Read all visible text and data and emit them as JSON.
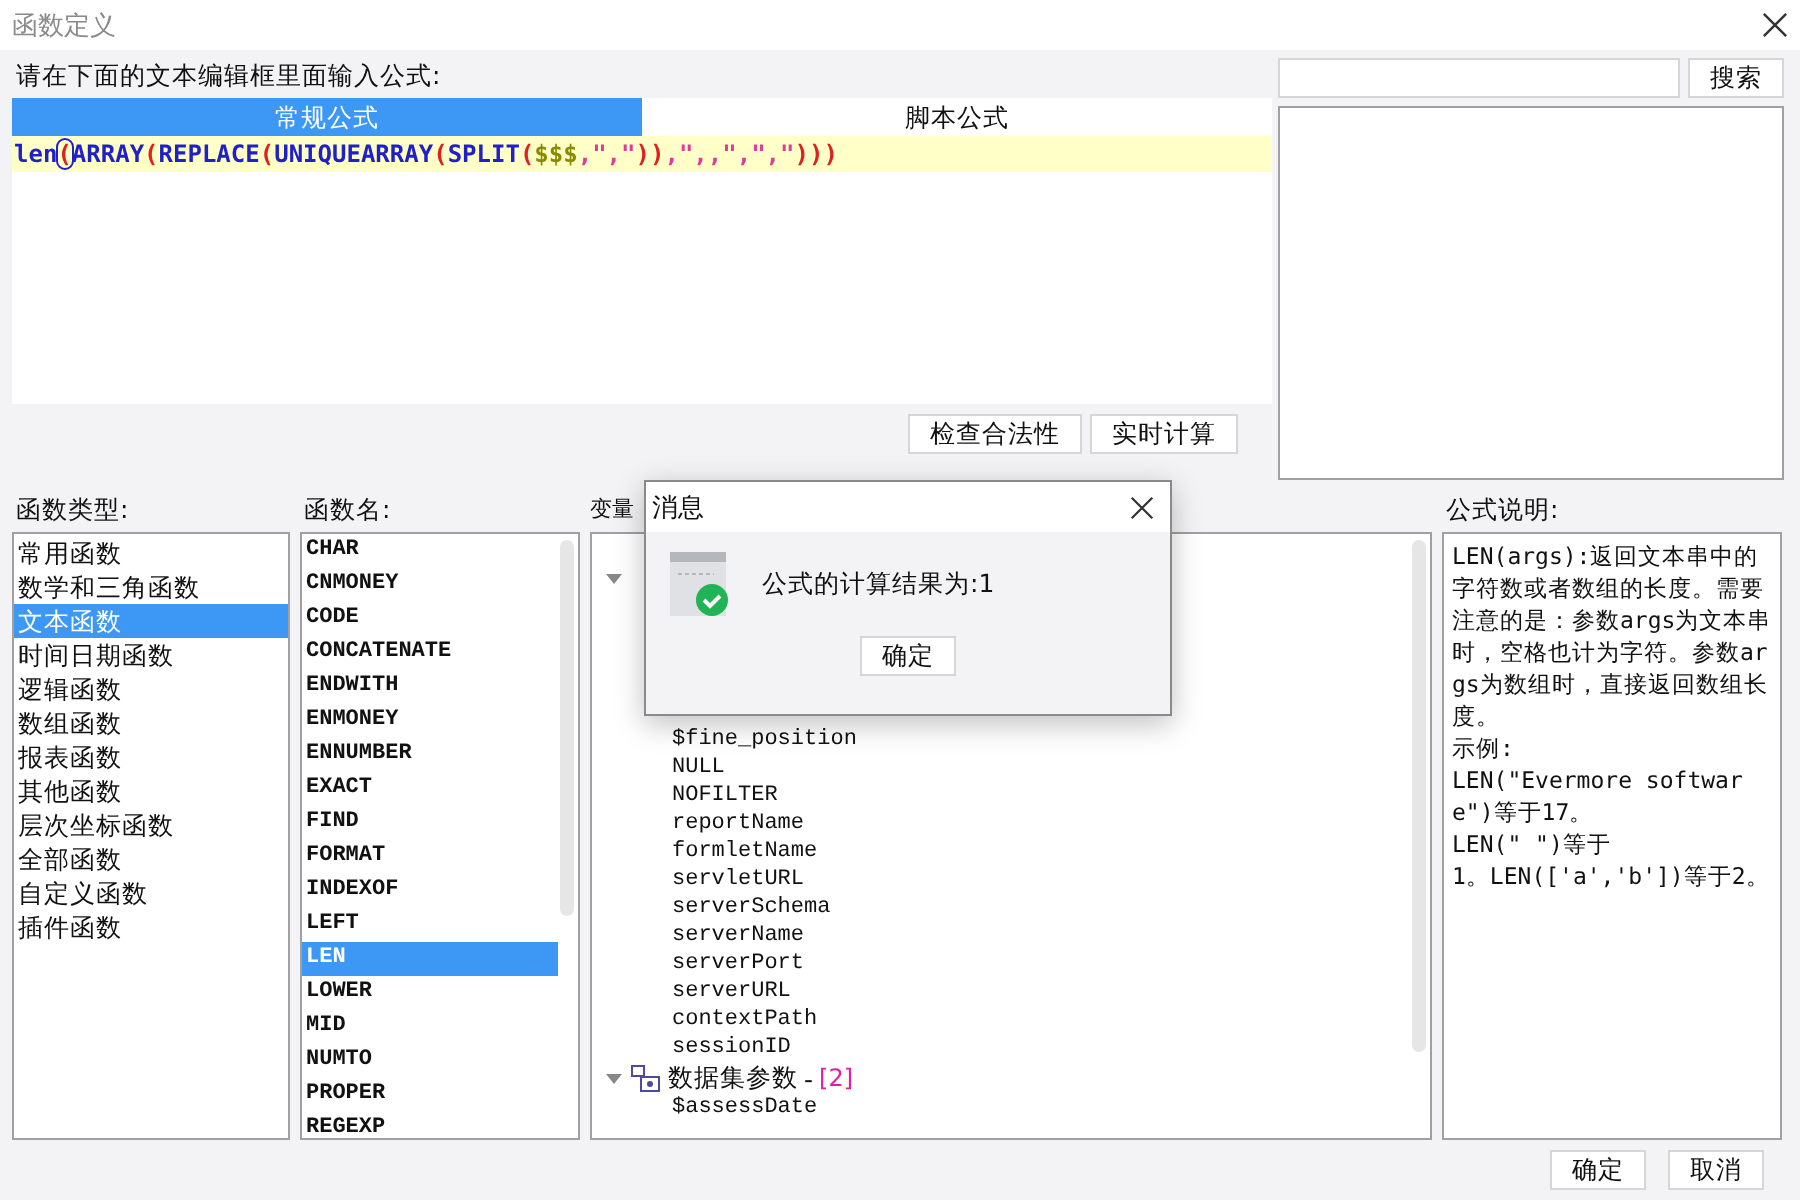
{
  "window": {
    "title": "函数定义"
  },
  "prompt": "请在下面的文本编辑框里面输入公式:",
  "formula_tabs": [
    {
      "label": "常规公式",
      "selected": true
    },
    {
      "label": "脚本公式",
      "selected": false
    }
  ],
  "formula_tokens": [
    {
      "text": "len",
      "kind": "func",
      "matched": false
    },
    {
      "text": "(",
      "kind": "paren",
      "matched": true
    },
    {
      "text": "ARRAY",
      "kind": "func",
      "matched": false
    },
    {
      "text": "(",
      "kind": "paren",
      "matched": false
    },
    {
      "text": "REPLACE",
      "kind": "func",
      "matched": false
    },
    {
      "text": "(",
      "kind": "paren",
      "matched": false
    },
    {
      "text": "UNIQUEARRAY",
      "kind": "func",
      "matched": false
    },
    {
      "text": "(",
      "kind": "paren",
      "matched": false
    },
    {
      "text": "SPLIT",
      "kind": "func",
      "matched": false
    },
    {
      "text": "(",
      "kind": "paren",
      "matched": false
    },
    {
      "text": "$$$",
      "kind": "var",
      "matched": false
    },
    {
      "text": ",\",\"",
      "kind": "string",
      "matched": false
    },
    {
      "text": "))",
      "kind": "paren",
      "matched": false
    },
    {
      "text": ",\",,\",\",\"",
      "kind": "string",
      "matched": false
    },
    {
      "text": ")))",
      "kind": "paren",
      "matched": false
    }
  ],
  "editor_buttons": [
    "检查合法性",
    "实时计算"
  ],
  "search": {
    "button": "搜索"
  },
  "function_types": {
    "label": "函数类型:",
    "items": [
      {
        "label": "常用函数",
        "selected": false
      },
      {
        "label": "数学和三角函数",
        "selected": false
      },
      {
        "label": "文本函数",
        "selected": true
      },
      {
        "label": "时间日期函数",
        "selected": false
      },
      {
        "label": "逻辑函数",
        "selected": false
      },
      {
        "label": "数组函数",
        "selected": false
      },
      {
        "label": "报表函数",
        "selected": false
      },
      {
        "label": "其他函数",
        "selected": false
      },
      {
        "label": "层次坐标函数",
        "selected": false
      },
      {
        "label": "全部函数",
        "selected": false
      },
      {
        "label": "自定义函数",
        "selected": false
      },
      {
        "label": "插件函数",
        "selected": false
      }
    ]
  },
  "function_names": {
    "label": "函数名:",
    "items": [
      {
        "label": "CHAR",
        "selected": false
      },
      {
        "label": "CNMONEY",
        "selected": false
      },
      {
        "label": "CODE",
        "selected": false
      },
      {
        "label": "CONCATENATE",
        "selected": false
      },
      {
        "label": "ENDWITH",
        "selected": false
      },
      {
        "label": "ENMONEY",
        "selected": false
      },
      {
        "label": "ENNUMBER",
        "selected": false
      },
      {
        "label": "EXACT",
        "selected": false
      },
      {
        "label": "FIND",
        "selected": false
      },
      {
        "label": "FORMAT",
        "selected": false
      },
      {
        "label": "INDEXOF",
        "selected": false
      },
      {
        "label": "LEFT",
        "selected": false
      },
      {
        "label": "LEN",
        "selected": true
      },
      {
        "label": "LOWER",
        "selected": false
      },
      {
        "label": "MID",
        "selected": false
      },
      {
        "label": "NUMTO",
        "selected": false
      },
      {
        "label": "PROPER",
        "selected": false
      },
      {
        "label": "REGEXP",
        "selected": false
      }
    ]
  },
  "variables": {
    "label": "变量",
    "groups": [
      {
        "expanded": true,
        "children": [
          "$fine_position",
          "NULL",
          "NOFILTER",
          "reportName",
          "formletName",
          "servletURL",
          "serverSchema",
          "serverName",
          "serverPort",
          "serverURL",
          "contextPath",
          "sessionID"
        ]
      },
      {
        "label": "数据集参数",
        "separator": "-",
        "count": "[2]",
        "expanded": true,
        "children": [
          "$assessDate"
        ]
      }
    ]
  },
  "description": {
    "label": "公式说明:",
    "paragraphs": [
      "LEN(args):返回文本串中的字符数或者数组的长度。需要注意的是：参数args为文本串时，空格也计为字符。参数args为数组时，直接返回数组长度。",
      "示例:",
      "LEN(\"Evermore software\")等于17。",
      "LEN(\" \")等于",
      "1。LEN(['a','b'])等于2。"
    ]
  },
  "footer_buttons": [
    "确定",
    "取消"
  ],
  "message_dialog": {
    "title": "消息",
    "text": "公式的计算结果为:1",
    "button": "确定"
  }
}
